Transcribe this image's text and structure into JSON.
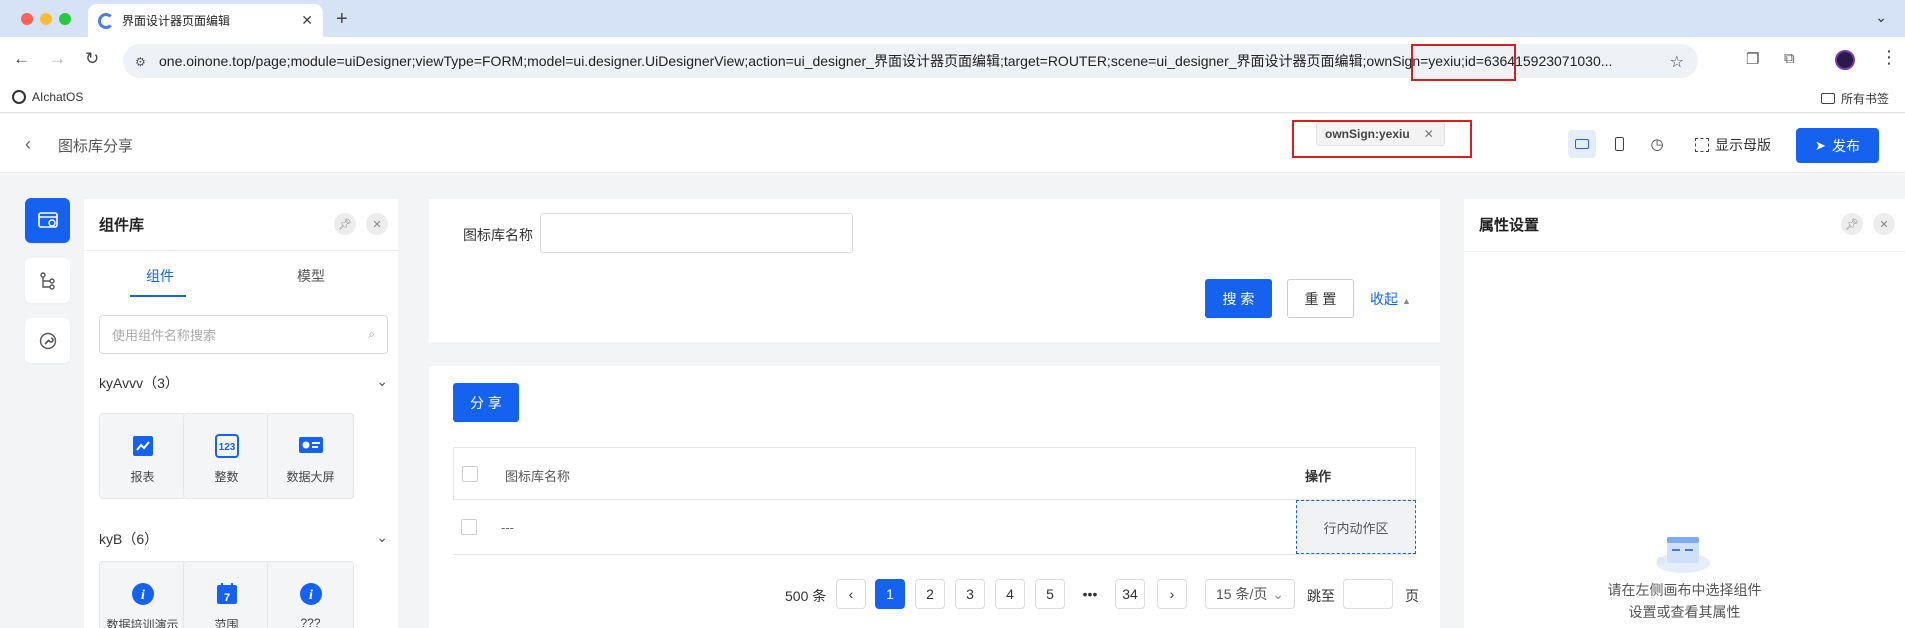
{
  "browser": {
    "tab_title": "界面设计器页面编辑",
    "url": "one.oinone.top/page;module=uiDesigner;viewType=FORM;model=ui.designer.UiDesignerView;action=ui_designer_界面设计器页面编辑;target=ROUTER;scene=ui_designer_界面设计器页面编辑;ownSign=yexiu;id=636415923071030...",
    "bookmark": "AIchatOS",
    "bookmarks_all": "所有书签"
  },
  "header": {
    "page_title": "图标库分享",
    "own_sign_tag": "ownSign:yexiu",
    "show_master": "显示母版",
    "publish": "发布"
  },
  "component_panel": {
    "title": "组件库",
    "tabs": [
      "组件",
      "模型"
    ],
    "search_placeholder": "使用组件名称搜索",
    "groups": [
      {
        "name": "kyAvvv（3）",
        "items": [
          "报表",
          "整数",
          "数据大屏"
        ]
      },
      {
        "name": "kyB（6）",
        "items": [
          "数据培训演示",
          "范围",
          "???"
        ]
      }
    ]
  },
  "search_form": {
    "field_label": "图标库名称",
    "search": "搜 索",
    "reset": "重 置",
    "collapse": "收起"
  },
  "table": {
    "share_button": "分 享",
    "columns": [
      "图标库名称",
      "操作"
    ],
    "rows": [
      {
        "name": "---",
        "action": "行内动作区"
      }
    ],
    "pagination": {
      "total": "500 条",
      "pages": [
        "1",
        "2",
        "3",
        "4",
        "5",
        "•••",
        "34"
      ],
      "current": "1",
      "page_size": "15 条/页",
      "jump_label": "跳至",
      "page_suffix": "页"
    }
  },
  "property_panel": {
    "title": "属性设置",
    "empty_line1": "请在左侧画布中选择组件",
    "empty_line2": "设置或查看其属性"
  },
  "colors": {
    "primary": "#1562f0",
    "highlight": "#d62020"
  }
}
